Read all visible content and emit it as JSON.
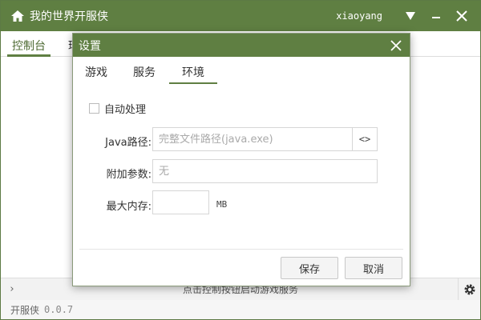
{
  "app": {
    "title": "我的世界开服侠",
    "username": "xiaoyang",
    "version_label": "开服侠",
    "version": "0.0.7"
  },
  "main_tabs": [
    {
      "label": "控制台",
      "active": true
    },
    {
      "label": "环",
      "active": false
    }
  ],
  "bottom": {
    "hint": "点击控制按钮启动游戏服务",
    "expand_glyph": "›"
  },
  "dialog": {
    "title": "设置",
    "tabs": [
      {
        "label": "游戏",
        "active": false
      },
      {
        "label": "服务",
        "active": false
      },
      {
        "label": "环境",
        "active": true
      }
    ],
    "auto_process_label": "自动处理",
    "auto_process_checked": false,
    "java_path": {
      "label": "Java路径:",
      "value": "",
      "placeholder": "完整文件路径(java.exe)",
      "browse_glyph": "<>"
    },
    "extra_args": {
      "label": "附加参数:",
      "value": "",
      "placeholder": "无"
    },
    "max_memory": {
      "label": "最大内存:",
      "value": "",
      "placeholder": "",
      "unit": "MB"
    },
    "save_label": "保存",
    "cancel_label": "取消"
  },
  "icons": {
    "home": "home-icon",
    "dropdown": "triangle-down-icon",
    "minimize": "minimize-icon",
    "close": "close-icon",
    "settings": "gear-icon"
  },
  "colors": {
    "accent": "#5f7f42",
    "accent_dark": "#4d6a33"
  }
}
